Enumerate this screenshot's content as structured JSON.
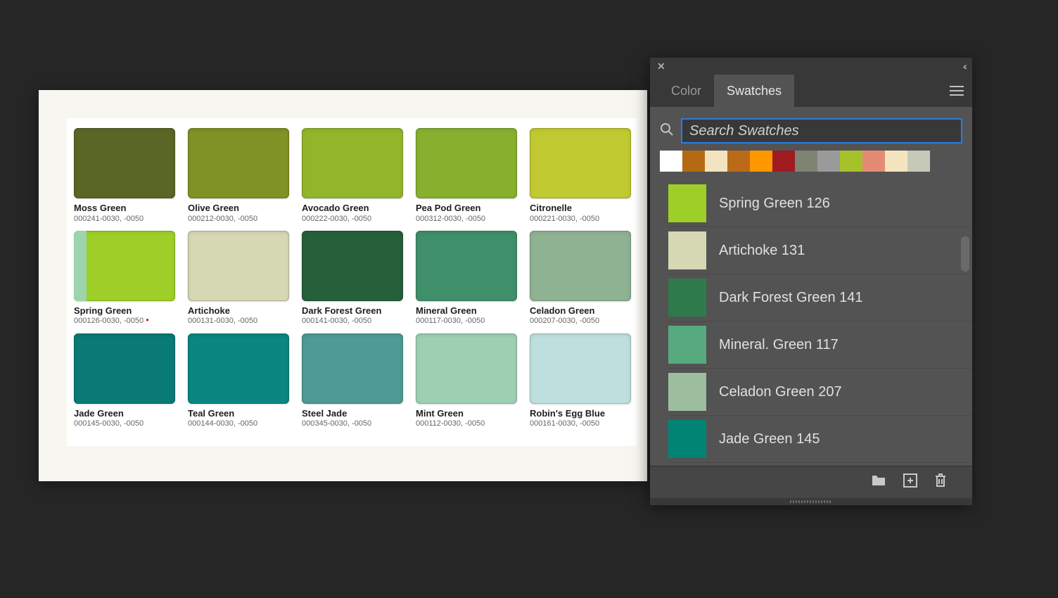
{
  "canvas": {
    "swatches": [
      {
        "name": "Moss Green",
        "code": "000241-0030, -0050",
        "color": "#5a6625"
      },
      {
        "name": "Olive Green",
        "code": "000212-0030, -0050",
        "color": "#809125"
      },
      {
        "name": "Avocado Green",
        "code": "000222-0030, -0050",
        "color": "#93b52b"
      },
      {
        "name": "Pea Pod Green",
        "code": "000312-0030, -0050",
        "color": "#88b02e"
      },
      {
        "name": "Citronelle",
        "code": "000221-0030, -0050",
        "color": "#c0c92f"
      },
      {
        "name": "Spring Green",
        "code": "000126-0030, -0050",
        "color": "#9ecf28",
        "spring": true,
        "dot": true
      },
      {
        "name": "Artichoke",
        "code": "000131-0030, -0050",
        "color": "#d6d7b3"
      },
      {
        "name": "Dark Forest Green",
        "code": "000141-0030, -0050",
        "color": "#25603a"
      },
      {
        "name": "Mineral Green",
        "code": "000117-0030, -0050",
        "color": "#3e8f6a"
      },
      {
        "name": "Celadon Green",
        "code": "000207-0030, -0050",
        "color": "#8fb293"
      },
      {
        "name": "Jade Green",
        "code": "000145-0030, -0050",
        "color": "#0a7a75"
      },
      {
        "name": "Teal Green",
        "code": "000144-0030, -0050",
        "color": "#0a8780"
      },
      {
        "name": "Steel Jade",
        "code": "000345-0030, -0050",
        "color": "#4d9b94"
      },
      {
        "name": "Mint Green",
        "code": "000112-0030, -0050",
        "color": "#9ecfb2"
      },
      {
        "name": "Robin's Egg Blue",
        "code": "000161-0030, -0050",
        "color": "#bde0de"
      }
    ]
  },
  "panel": {
    "tabs": {
      "color": "Color",
      "swatches": "Swatches"
    },
    "search": {
      "placeholder": "Search Swatches"
    },
    "recent_colors": [
      "#ffffff",
      "#b56a12",
      "#f3e3bf",
      "#bb6a1a",
      "#ff9700",
      "#a01b1f",
      "#7f8374",
      "#9a9a9a",
      "#a6c22a",
      "#e58b74",
      "#f5e4c0",
      "#c6c9ba"
    ],
    "list": [
      {
        "label": "Spring Green 126",
        "color": "#9ecf28"
      },
      {
        "label": "Artichoke 131",
        "color": "#d6d7b3"
      },
      {
        "label": "Dark Forest Green 141",
        "color": "#2f7a4a"
      },
      {
        "label": "Mineral. Green 117",
        "color": "#57aa80"
      },
      {
        "label": "Celadon Green 207",
        "color": "#9cbe9e"
      },
      {
        "label": "Jade Green 145",
        "color": "#008575"
      }
    ]
  }
}
